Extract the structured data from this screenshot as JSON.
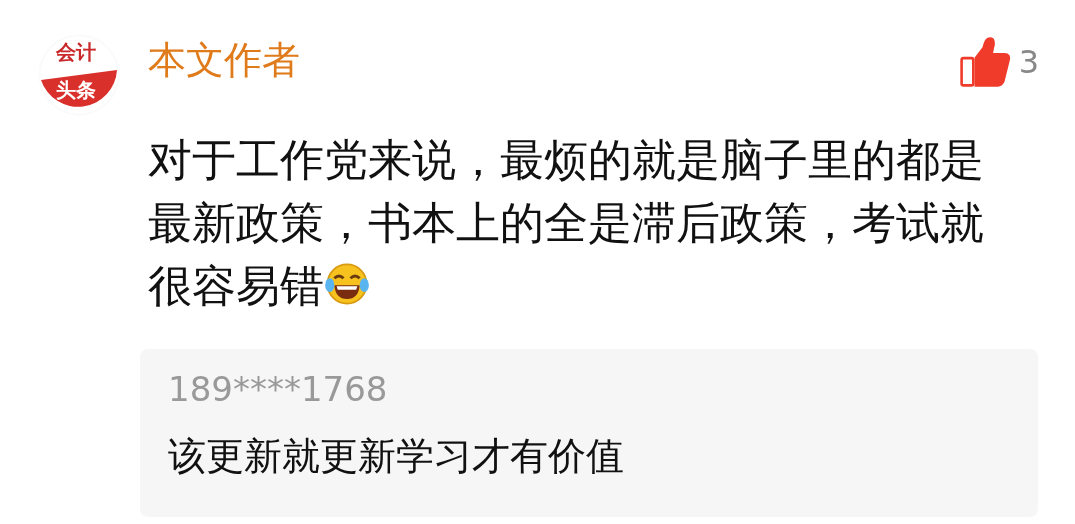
{
  "comment": {
    "avatar": {
      "line_1": "会计",
      "line_2": "头条"
    },
    "author": "本文作者",
    "like": {
      "liked": true,
      "count": "3"
    },
    "text": "对于工作党来说，最烦的就是脑子里的都是最新政策，书本上的全是滞后政策，考试就很容易错",
    "emoji": true
  },
  "reply": {
    "user": "189****1768",
    "text": "该更新就更新学习才有价值"
  }
}
